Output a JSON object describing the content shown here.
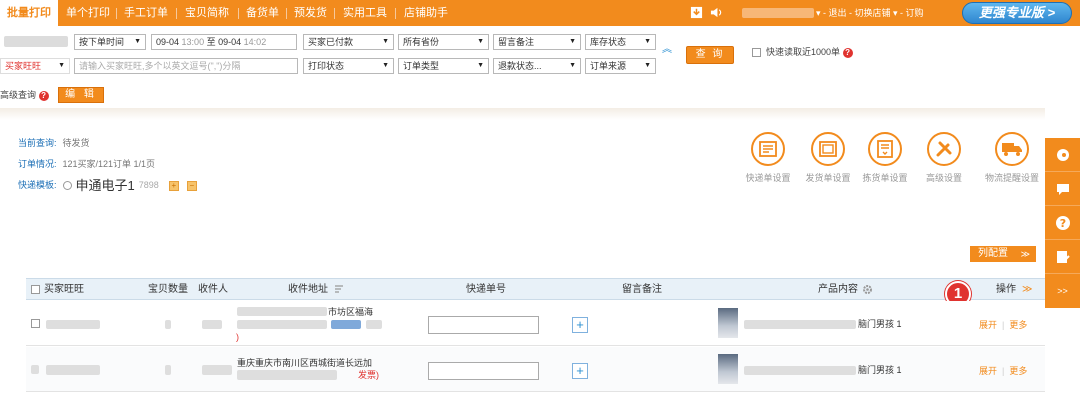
{
  "topbar": {
    "tabs": [
      "批量打印",
      "单个打印",
      "手工订单",
      "宝贝简称",
      "备货单",
      "预发货",
      "实用工具",
      "店铺助手"
    ],
    "links": "▾ - 退出 - 切换店铺 ▾ - 订购",
    "upgrade_label": "更强专业版 >"
  },
  "filters": {
    "order_time": "按下单时间",
    "date_from": "09-04",
    "time_from": "13:00",
    "date_to_sep": "至",
    "date_to": "09-04",
    "time_to": "14:02",
    "pay_status": "买家已付款",
    "province": "所有省份",
    "memo": "留言备注",
    "stock": "库存状态",
    "buyer_field": "买家旺旺",
    "buyer_placeholder": "请输入买家旺旺,多个以英文逗号(\",\")分隔",
    "print_status": "打印状态",
    "order_type": "订单类型",
    "refund_status": "退款状态...",
    "order_source": "订单来源",
    "search_label": "查 询",
    "fast_label": "快速读取近1000单",
    "adv_label": "高级查询",
    "edit_label": "编 辑"
  },
  "info": {
    "current_query_label": "当前查询:",
    "current_query_value": "待发货",
    "order_label": "订单情况:",
    "order_value": "121买家/121订单   1/1页",
    "template_label": "快递模板:",
    "express_name": "申通电子1",
    "express_count": "7898"
  },
  "settings": [
    "快递单设置",
    "发货单设置",
    "拣货单设置",
    "高级设置",
    "物流提醒设置"
  ],
  "column_setting_label": "列配置",
  "table": {
    "headers": [
      "买家旺旺",
      "宝贝数量",
      "收件人",
      "收件地址",
      "快递单号",
      "留言备注",
      "产品内容",
      "操作"
    ],
    "rows": [
      {
        "address_line1": "市坊区福海",
        "address_mark": ")",
        "product_tail": "脑门男孩 1",
        "expand": "展开",
        "more": "更多"
      },
      {
        "address_line1": "重庆重庆市南川区西城街道长远加",
        "address_mark": "发票)",
        "product_tail": "脑门男孩 1",
        "expand": "展开",
        "more": "更多"
      }
    ]
  },
  "annotation_number": "1",
  "colors": {
    "accent": "#f28b1d",
    "link": "#1c6fb6",
    "danger": "#e0332f"
  }
}
